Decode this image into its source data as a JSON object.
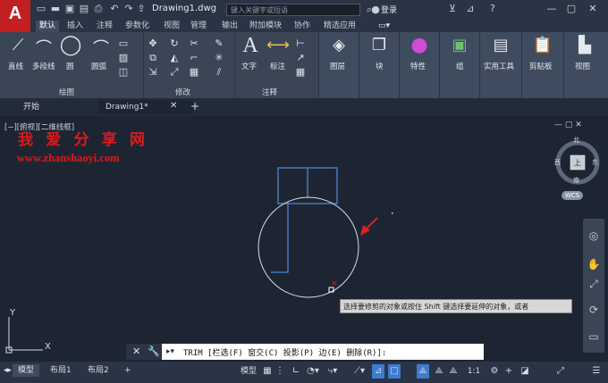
{
  "app": {
    "logo": "A",
    "title": "Drawing1.dwg",
    "search_placeholder": "键入关键字或短语",
    "login": "登录"
  },
  "ribbon_tabs": [
    "默认",
    "插入",
    "注释",
    "参数化",
    "视图",
    "管理",
    "输出",
    "附加模块",
    "协作",
    "精选应用"
  ],
  "draw_panel": {
    "tools": [
      "直线",
      "多段线",
      "圆",
      "圆弧"
    ],
    "title": "绘图"
  },
  "modify_panel": {
    "title": "修改"
  },
  "annotation_panel": {
    "tools": [
      "文字",
      "标注"
    ],
    "title": "注释"
  },
  "big_buttons": [
    "图层",
    "块",
    "特性",
    "组",
    "实用工具",
    "剪贴板",
    "视图"
  ],
  "file_tabs": [
    "开始",
    "Drawing1*"
  ],
  "viewport_label": "[−][俯视][二维线框]",
  "watermark": {
    "line1": "我 爱 分 享 网",
    "line2": "www.zhanshaoyi.com"
  },
  "viewcube": {
    "north": "北",
    "south": "南",
    "east": "东",
    "west": "西",
    "top": "上",
    "wcs": "WCS"
  },
  "tooltip": "选择要修剪的对象或按住 Shift 键选择要延伸的对象，或者",
  "command": {
    "text": "TRIM [栏选(F) 窗交(C) 投影(P) 边(E) 删除(R)]:"
  },
  "layout_tabs": [
    "模型",
    "布局1",
    "布局2"
  ],
  "status": {
    "model": "模型",
    "scale": "1:1"
  },
  "axis": {
    "y": "Y",
    "x": "X"
  }
}
